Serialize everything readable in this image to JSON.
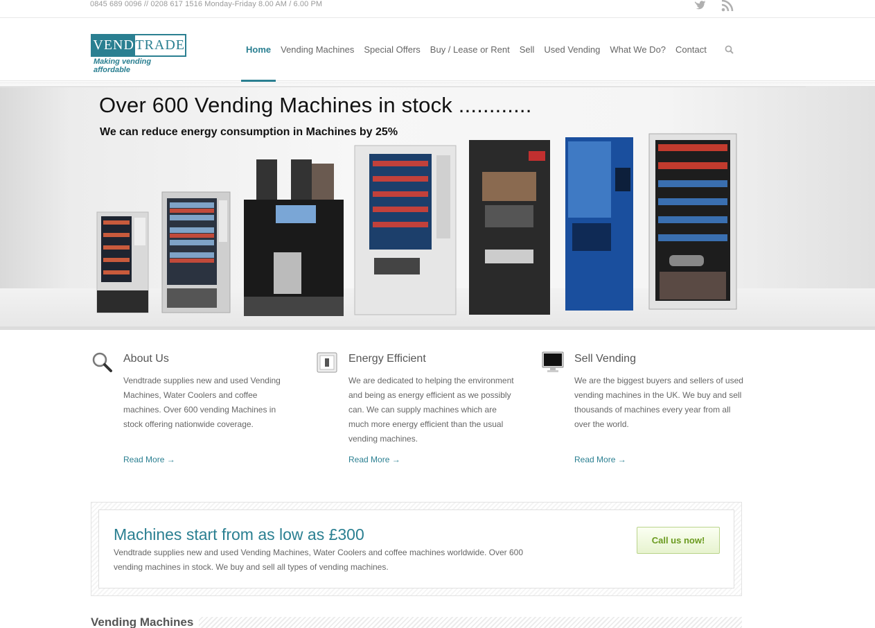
{
  "topbar": {
    "phone": "0845 689 0096 // 0208 617 1516 Monday-Friday 8.00 AM / 6.00 PM",
    "twitter_icon": "twitter-icon",
    "rss_icon": "rss-icon"
  },
  "logo": {
    "vend": "VEND",
    "trade": "TRADE",
    "tagline": "Making vending affordable"
  },
  "nav": {
    "items": [
      {
        "label": "Home"
      },
      {
        "label": "Vending Machines"
      },
      {
        "label": "Special Offers"
      },
      {
        "label": "Buy / Lease or Rent"
      },
      {
        "label": "Sell"
      },
      {
        "label": "Used Vending"
      },
      {
        "label": "What We Do?"
      },
      {
        "label": "Contact"
      }
    ],
    "active": "Home",
    "search_icon": "search-icon"
  },
  "hero": {
    "title": "Over 600 Vending Machines in stock ............",
    "subtitle": "We can reduce energy consumption in Machines by 25%"
  },
  "features": [
    {
      "icon": "magnifier-icon",
      "title": "About Us",
      "text": "Vendtrade supplies new and used Vending Machines, Water Coolers and coffee machines. Over 600 vending Machines in stock offering nationwide coverage.",
      "link": "Read More →"
    },
    {
      "icon": "light-switch-icon",
      "title": "Energy Efficient",
      "text": "We are dedicated to helping the environment and being as energy efficient as we possibly can. We can supply machines which are much more energy efficient than the usual vending machines.",
      "link": "Read More →"
    },
    {
      "icon": "monitor-icon",
      "title": "Sell Vending",
      "text": "We are the biggest buyers and sellers of used vending machines in the UK. We buy and sell thousands of machines every year from all over the world.",
      "link": "Read More →"
    }
  ],
  "callout": {
    "title": "Machines start from as low as £300",
    "text": "Vendtrade supplies new and used Vending Machines, Water Coolers and coffee machines worldwide. Over 600 vending machines in stock. We buy and sell all types of vending machines.",
    "button": "Call us now!"
  },
  "section": {
    "title": "Vending Machines"
  },
  "colors": {
    "accent": "#2a7f91",
    "button_text": "#6a9a1f"
  }
}
